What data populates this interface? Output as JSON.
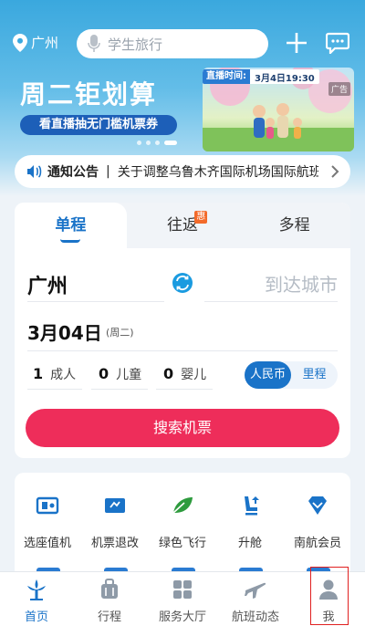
{
  "header": {
    "location": "广州",
    "search_placeholder": "学生旅行"
  },
  "banner": {
    "title": "周二钜划算",
    "subtitle": "看直播抽无门槛机票券",
    "live_label": "直播时间:",
    "live_time": "3月4日19:30",
    "ad_label": "广告",
    "page_count": 4,
    "active_page": 3
  },
  "notice": {
    "label": "通知公告",
    "separator": "|",
    "text": "关于调整乌鲁木齐国际机场国际航班..."
  },
  "booking": {
    "tabs": [
      "单程",
      "往返",
      "多程"
    ],
    "active_tab": 0,
    "roundtrip_badge": "惠",
    "from_city": "广州",
    "to_city_placeholder": "到达城市",
    "date": "3月04日",
    "weekday": "(周二)",
    "passengers": [
      {
        "count": "1",
        "label": "成人"
      },
      {
        "count": "0",
        "label": "儿童"
      },
      {
        "count": "0",
        "label": "婴儿"
      }
    ],
    "currency": [
      "人民币",
      "里程"
    ],
    "currency_selected": 0,
    "search_button": "搜索机票"
  },
  "services": [
    {
      "label": "选座值机",
      "icon": "seat-checkin-icon"
    },
    {
      "label": "机票退改",
      "icon": "ticket-change-icon"
    },
    {
      "label": "绿色飞行",
      "icon": "green-leaf-icon"
    },
    {
      "label": "升舱",
      "icon": "upgrade-seat-icon"
    },
    {
      "label": "南航会员",
      "icon": "member-diamond-icon"
    }
  ],
  "bottom_nav": {
    "items": [
      "首页",
      "行程",
      "服务大厅",
      "航班动态",
      "我"
    ],
    "active": 0
  },
  "colors": {
    "accent": "#1a73c8",
    "search_button": "#ee2d5a",
    "highlight_box": "#e02020"
  }
}
